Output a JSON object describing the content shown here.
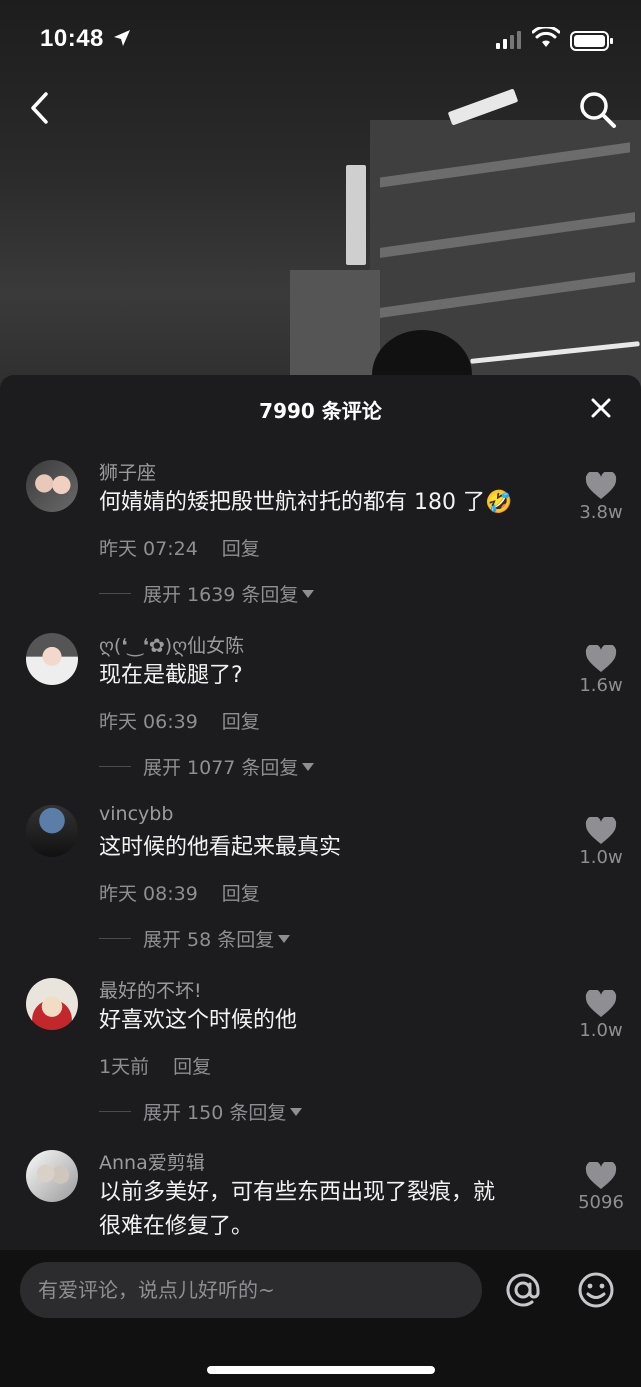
{
  "status_bar": {
    "time": "10:48"
  },
  "sheet": {
    "title": "7990 条评论"
  },
  "comments": [
    {
      "name": "狮子座",
      "text": "何婧婧的矮把殷世航衬托的都有 180 了🤣",
      "time": "昨天 07:24",
      "reply": "回复",
      "expand": "展开 1639 条回复",
      "likes": "3.8w"
    },
    {
      "name": "ღ(❛‿❛✿)ღ仙女陈",
      "text": "现在是截腿了?",
      "time": "昨天 06:39",
      "reply": "回复",
      "expand": "展开 1077 条回复",
      "likes": "1.6w"
    },
    {
      "name": "vincybb",
      "text": "这时候的他看起来最真实",
      "time": "昨天 08:39",
      "reply": "回复",
      "expand": "展开 58 条回复",
      "likes": "1.0w"
    },
    {
      "name": "最好的不坏!",
      "text": "好喜欢这个时候的他",
      "time": "1天前",
      "reply": "回复",
      "expand": "展开 150 条回复",
      "likes": "1.0w"
    },
    {
      "name": "Anna爱剪辑",
      "text_line1": "以前多美好，可有些东西出现了裂痕，就",
      "text_line2": "很难在修复了。",
      "likes": "5096"
    }
  ],
  "input": {
    "placeholder": "有爱评论，说点儿好听的~"
  },
  "icons": [
    "back-icon",
    "search-icon",
    "close-icon",
    "heart-icon",
    "at-icon",
    "emoji-icon"
  ]
}
